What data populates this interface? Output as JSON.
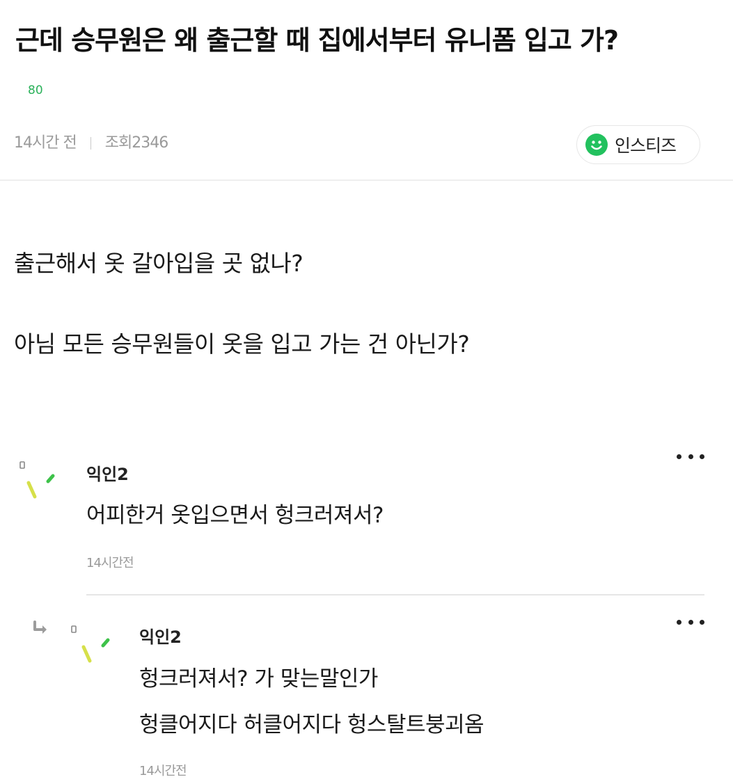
{
  "post": {
    "title": "근데 승무원은 왜 출근할 때 집에서부터 유니폼 입고 가?",
    "like_count": "80",
    "time_ago": "14시간 전",
    "views": "조회2346",
    "board": "인스티즈",
    "body": [
      "출근해서 옷 갈아입을 곳 없나?",
      "아님 모든 승무원들이 옷을 입고 가는 건 아닌가?"
    ]
  },
  "comments": [
    {
      "nickname": "익인2",
      "text": [
        "어피한거 옷입으면서 헝크러져서?"
      ],
      "time": "14시간전"
    },
    {
      "nickname": "익인2",
      "text": [
        "헝크러져서? 가 맞는말인가",
        "헝클어지다 허클어지다 헝스탈트붕괴옴"
      ],
      "time": "14시간전",
      "is_reply": true
    }
  ],
  "colors": {
    "accent_green": "#22c15e",
    "like_green": "#2bb15a",
    "meta_gray": "#9a9a9a",
    "avatar_yellow": "#d6e04a",
    "avatar_green": "#3ec24a"
  },
  "icons": {
    "board": "smiley-icon",
    "more": "more-dots-icon",
    "reply": "reply-arrow-icon",
    "avatar": "anonymous-avatar-icon"
  }
}
